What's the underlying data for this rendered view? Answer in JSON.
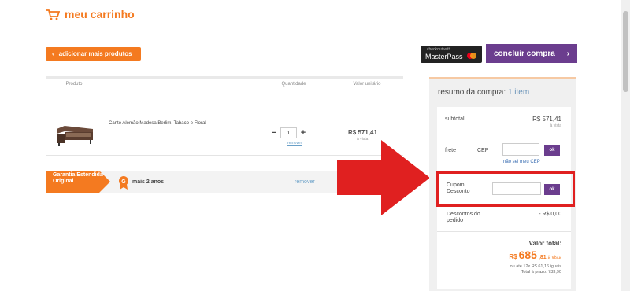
{
  "header": {
    "title": "meu carrinho"
  },
  "actions": {
    "continue_label": "adicionar mais produtos",
    "masterpass_small": "checkout with",
    "masterpass_label": "MasterPass",
    "checkout_label": "concluir compra"
  },
  "cart": {
    "columns": [
      "Produto",
      "Quantidade",
      "Valor unitário"
    ],
    "items": [
      {
        "name": "Canto Alemão Madesa Berlim, Tabaco e Floral",
        "quantity": "1",
        "remove": "remover",
        "price": "R$ 571,41",
        "price_note": "à vista"
      }
    ],
    "warranty": {
      "tag": "Garantia Estendida Original",
      "text": "mais 2 anos",
      "remove": "remover"
    }
  },
  "summary": {
    "title": "resumo da compra:",
    "count": "1 item",
    "subtotal_label": "subtotal",
    "subtotal_value": "R$ 571,41",
    "subtotal_note": "à vista",
    "shipping_label": "frete",
    "cep_label": "CEP",
    "ok_label": "ok",
    "cep_link": "não sei meu CEP",
    "coupon_label": "Cupom Desconto",
    "discounts_label": "Descontos do pedido",
    "discounts_value": "- R$ 0,00",
    "total_label": "Valor total:",
    "total_currency": "R$",
    "total_integer": "685",
    "total_cents": ",81",
    "total_note": "à vista",
    "installments": "ou até 12x R$ 61,16 iguais",
    "term_total": "Total à prazo: 733,90"
  },
  "colors": {
    "accent": "#f47a20",
    "purple": "#6b3d8e",
    "highlight": "#e02020"
  }
}
